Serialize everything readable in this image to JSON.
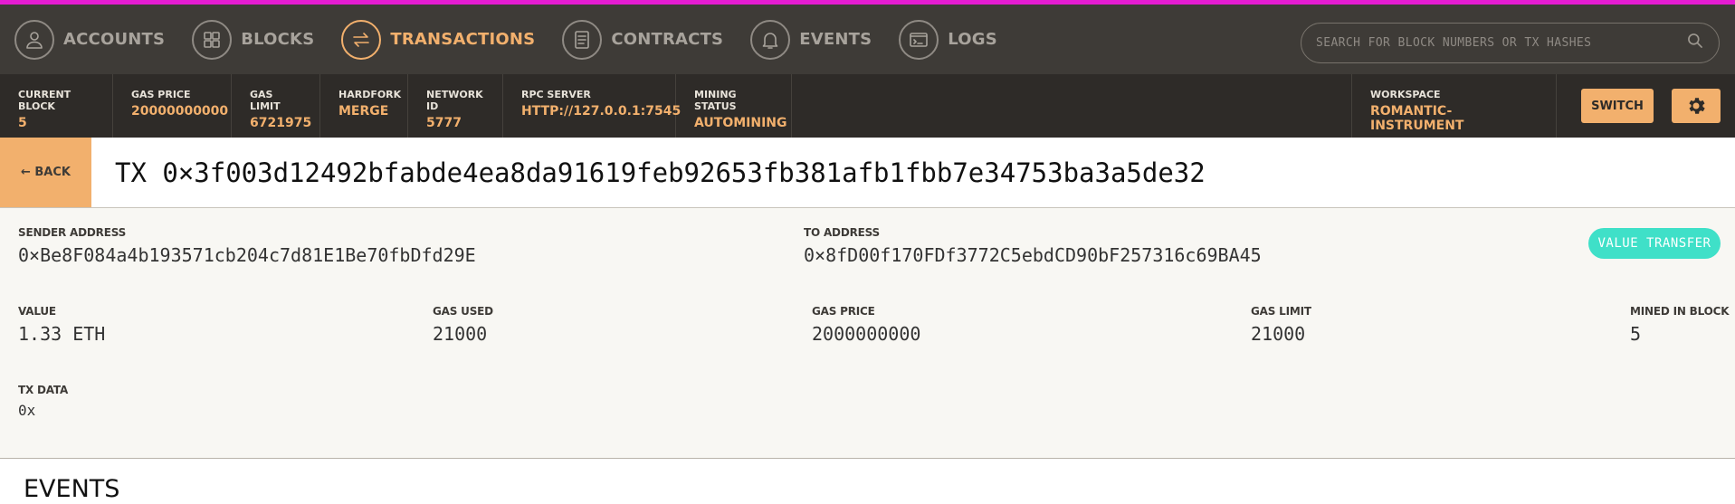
{
  "nav": {
    "items": [
      {
        "label": "ACCOUNTS",
        "icon": "user-icon",
        "active": false
      },
      {
        "label": "BLOCKS",
        "icon": "blocks-icon",
        "active": false
      },
      {
        "label": "TRANSACTIONS",
        "icon": "transfer-arrows-icon",
        "active": true
      },
      {
        "label": "CONTRACTS",
        "icon": "document-icon",
        "active": false
      },
      {
        "label": "EVENTS",
        "icon": "bell-icon",
        "active": false
      },
      {
        "label": "LOGS",
        "icon": "terminal-icon",
        "active": false
      }
    ],
    "search_placeholder": "SEARCH FOR BLOCK NUMBERS OR TX HASHES"
  },
  "status": {
    "current_block": {
      "title": "CURRENT BLOCK",
      "value": "5"
    },
    "gas_price": {
      "title": "GAS PRICE",
      "value": "20000000000"
    },
    "gas_limit": {
      "title": "GAS LIMIT",
      "value": "6721975"
    },
    "hardfork": {
      "title": "HARDFORK",
      "value": "MERGE"
    },
    "network_id": {
      "title": "NETWORK ID",
      "value": "5777"
    },
    "rpc_server": {
      "title": "RPC SERVER",
      "value": "HTTP://127.0.0.1:7545"
    },
    "mining_status": {
      "title": "MINING STATUS",
      "value": "AUTOMINING"
    },
    "workspace": {
      "title": "WORKSPACE",
      "value": "ROMANTIC-INSTRUMENT"
    },
    "switch_label": "SWITCH"
  },
  "tx": {
    "back_label": "← BACK",
    "title": "TX 0×3f003d12492bfabde4ea8da91619feb92653fb381afb1fbb7e34753ba3a5de32",
    "badge": "VALUE TRANSFER",
    "sender": {
      "label": "SENDER ADDRESS",
      "value": "0×Be8F084a4b193571cb204c7d81E1Be70fbDfd29E"
    },
    "to": {
      "label": "TO ADDRESS",
      "value": "0×8fD00f170FDf3772C5ebdCD90bF257316c69BA45"
    },
    "value": {
      "label": "VALUE",
      "value": "1.33 ETH"
    },
    "gas_used": {
      "label": "GAS USED",
      "value": "21000"
    },
    "gas_price": {
      "label": "GAS PRICE",
      "value": "2000000000"
    },
    "gas_limit": {
      "label": "GAS LIMIT",
      "value": "21000"
    },
    "mined_in_block": {
      "label": "MINED IN BLOCK",
      "value": "5"
    },
    "tx_data": {
      "label": "TX DATA",
      "value": "0x"
    }
  },
  "events": {
    "title": "EVENTS"
  },
  "colors": {
    "accent": "#f2b06d",
    "top_border": "#e51cd1",
    "badge": "#3fe0c8",
    "nav_bg": "#3e3b37",
    "status_bg": "#2e2b28"
  }
}
